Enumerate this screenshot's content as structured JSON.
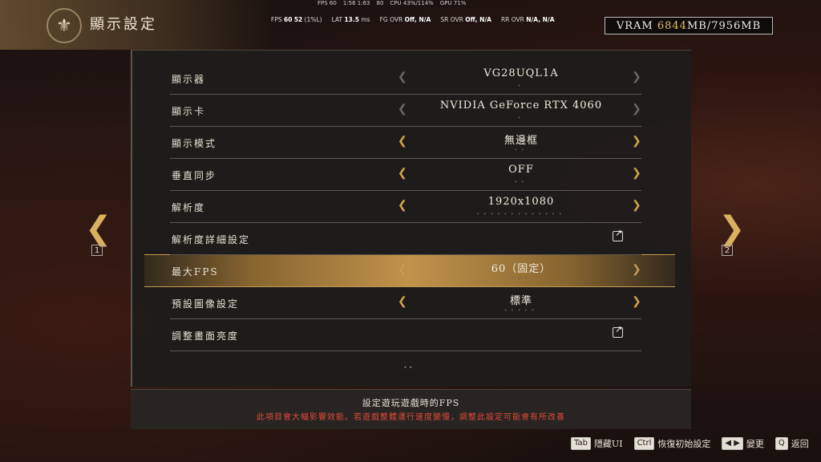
{
  "header": {
    "title": "顯示設定",
    "emblem": "⚜"
  },
  "overlay_top": [
    "FPS 60",
    "1:56 1:63",
    "80",
    "CPU 43%/114%",
    "GPU 71%"
  ],
  "stats": {
    "fps_label": "FPS",
    "fps": "60",
    "fps_low": "52",
    "fps_low_tag": "(1%L)",
    "lat_label": "LAT",
    "lat": "13.5",
    "lat_unit": "ms",
    "fg_label": "FG OVR",
    "fg": "Off, N/A",
    "sr_label": "SR OVR",
    "sr": "Off, N/A",
    "rr_label": "RR OVR",
    "rr": "N/A, N/A"
  },
  "vram": {
    "label": "VRAM",
    "used": "6844",
    "unit1": "MB",
    "sep": "/",
    "total": "7956",
    "unit2": "MB"
  },
  "settings": [
    {
      "label": "顯示器",
      "value": "VG28UQL1A",
      "dots": "•"
    },
    {
      "label": "顯示卡",
      "value": "NVIDIA GeForce RTX 4060",
      "dots": "•"
    },
    {
      "label": "顯示模式",
      "value": "無邊框",
      "dots": "••"
    },
    {
      "label": "垂直同步",
      "value": "OFF",
      "dots": "••"
    },
    {
      "label": "解析度",
      "value": "1920x1080",
      "dots": "•••••••••••••"
    },
    {
      "label": "解析度詳細設定",
      "value": "",
      "dots": ""
    },
    {
      "label": "最大FPS",
      "value": "60（固定）",
      "dots": "•••"
    },
    {
      "label": "預設圖像設定",
      "value": "標準",
      "dots": "•••••"
    },
    {
      "label": "調整畫面亮度",
      "value": "",
      "dots": ""
    }
  ],
  "arrows": {
    "left": "❮",
    "right": "❯",
    "page_left": "❮",
    "page_right": "❯"
  },
  "page_numbers": {
    "left": "1",
    "right": "2"
  },
  "pager": "••",
  "description": {
    "title": "設定遊玩遊戲時的FPS",
    "warning": "此項目會大幅影響效能。若遊戲整體運行速度變慢，調整此設定可能會有所改善"
  },
  "controls": {
    "tab_key": "Tab",
    "tab_label": "隱藏UI",
    "ctrl_key": "Ctrl",
    "ctrl_label": "恢復初始設定",
    "arrow_keys": "◀ ▶",
    "arrow_label": "變更",
    "q_key": "Q",
    "q_label": "返回"
  },
  "colors": {
    "accent": "#d8a24a",
    "warning": "#e04a3a"
  }
}
